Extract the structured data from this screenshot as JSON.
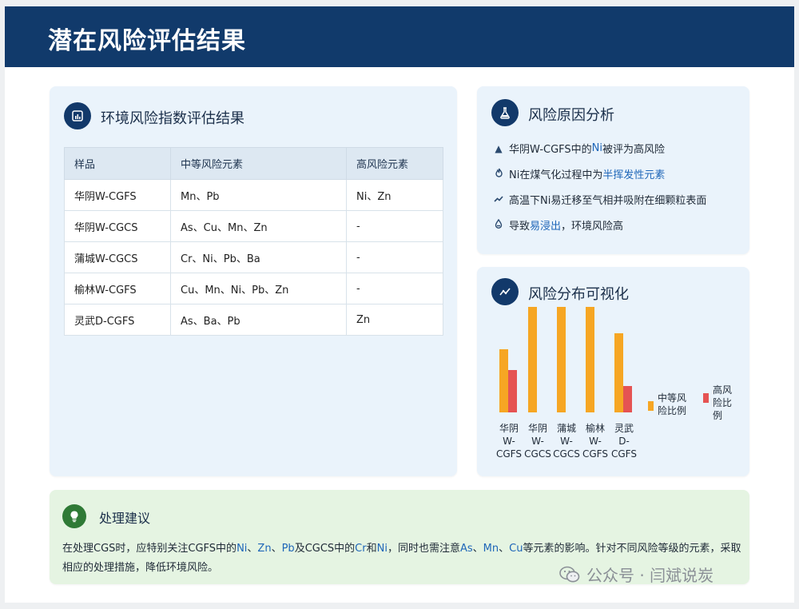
{
  "header": {
    "title": "潜在风险评估结果"
  },
  "index_card": {
    "title": "环境风险指数评估结果",
    "icon": "bar-chart-icon",
    "columns": [
      "样品",
      "中等风险元素",
      "高风险元素"
    ],
    "rows": [
      {
        "sample": "华阴W-CGFS",
        "moderate": "Mn、Pb",
        "high": "Ni、Zn"
      },
      {
        "sample": "华阴W-CGCS",
        "moderate": "As、Cu、Mn、Zn",
        "high": "-"
      },
      {
        "sample": "蒲城W-CGCS",
        "moderate": "Cr、Ni、Pb、Ba",
        "high": "-"
      },
      {
        "sample": "榆林W-CGFS",
        "moderate": "Cu、Mn、Ni、Pb、Zn",
        "high": "-"
      },
      {
        "sample": "灵武D-CGFS",
        "moderate": "As、Ba、Pb",
        "high": "Zn"
      }
    ]
  },
  "cause_card": {
    "title": "风险原因分析",
    "icon": "flask-icon",
    "items": [
      {
        "icon": "warning-icon",
        "pre": "华阴W-CGFS中的",
        "hl": "Ni",
        "post": "被评为高风险"
      },
      {
        "icon": "flame-icon",
        "pre": "Ni在煤气化过程中为",
        "hl": "半挥发性元素",
        "post": ""
      },
      {
        "icon": "trend-icon",
        "pre": "高温下Ni易迁移至气相并吸附在细颗粒表面",
        "hl": "",
        "post": ""
      },
      {
        "icon": "droplet-icon",
        "pre": "导致",
        "hl": "易浸出",
        "post": "，环境风险高"
      }
    ]
  },
  "chart_card": {
    "title": "风险分布可视化",
    "icon": "line-chart-icon"
  },
  "chart_data": {
    "type": "bar",
    "categories": [
      "华阴W-CGFS",
      "华阴W-CGCS",
      "蒲城W-CGCS",
      "榆林W-CGFS",
      "灵武D-CGFS"
    ],
    "category_lines": [
      [
        "华阴",
        "W-",
        "CGFS"
      ],
      [
        "华阴",
        "W-",
        "CGCS"
      ],
      [
        "蒲城",
        "W-",
        "CGCS"
      ],
      [
        "榆林",
        "W-",
        "CGFS"
      ],
      [
        "灵武",
        "D-",
        "CGFS"
      ]
    ],
    "series": [
      {
        "name": "中等风险比例",
        "name_lines": [
          "中等风",
          "险比例"
        ],
        "color": "#f6a623",
        "values": [
          60,
          100,
          100,
          100,
          75
        ]
      },
      {
        "name": "高风险比例",
        "name_lines": [
          "高风",
          "险比",
          "例"
        ],
        "color": "#e55353",
        "values": [
          40,
          0,
          0,
          0,
          25
        ]
      }
    ],
    "ylim": [
      0,
      100
    ],
    "legend": "right"
  },
  "suggestion": {
    "title": "处理建议",
    "icon": "lightbulb-icon",
    "parts": [
      {
        "t": "在处理CGS时，应特别关注CGFS中的",
        "c": ""
      },
      {
        "t": "Ni",
        "c": "blue"
      },
      {
        "t": "、",
        "c": ""
      },
      {
        "t": "Zn",
        "c": "blue"
      },
      {
        "t": "、",
        "c": ""
      },
      {
        "t": "Pb",
        "c": "blue"
      },
      {
        "t": "及CGCS中的",
        "c": ""
      },
      {
        "t": "Cr",
        "c": "blue"
      },
      {
        "t": "和",
        "c": ""
      },
      {
        "t": "Ni",
        "c": "blue"
      },
      {
        "t": "，同时也需注意",
        "c": ""
      },
      {
        "t": "As",
        "c": "blue"
      },
      {
        "t": "、",
        "c": ""
      },
      {
        "t": "Mn",
        "c": "blue"
      },
      {
        "t": "、",
        "c": ""
      },
      {
        "t": "Cu",
        "c": "blue"
      },
      {
        "t": "等元素的影响。针对不同风险等级的元素，采取相应的处理措施，降低环境风险。",
        "c": ""
      }
    ]
  },
  "watermark": {
    "text": "公众号 · 闫斌说炭",
    "icon": "wechat-icon"
  }
}
